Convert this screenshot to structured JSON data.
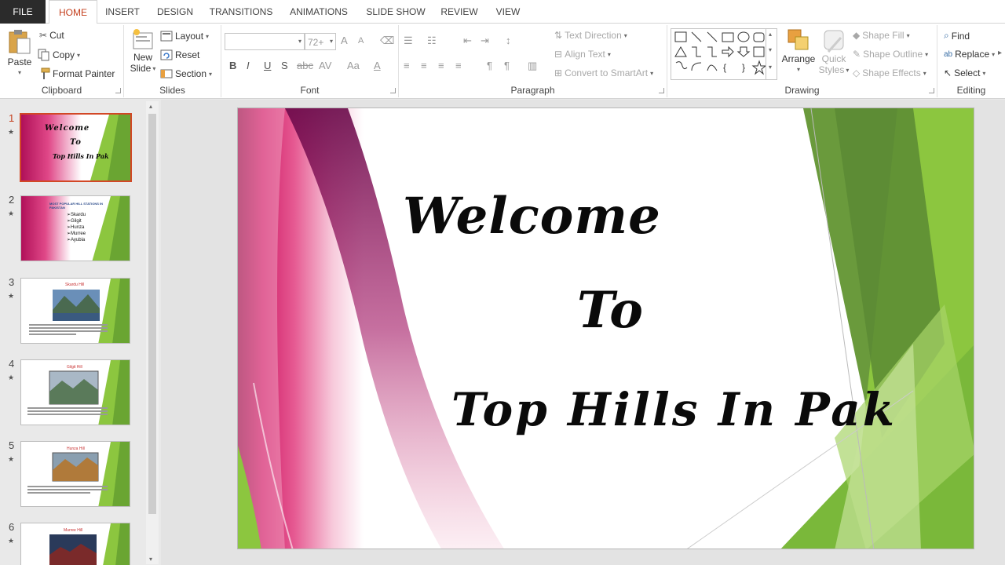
{
  "tabs": [
    {
      "label": "FILE"
    },
    {
      "label": "HOME"
    },
    {
      "label": "INSERT"
    },
    {
      "label": "DESIGN"
    },
    {
      "label": "TRANSITIONS"
    },
    {
      "label": "ANIMATIONS"
    },
    {
      "label": "SLIDE SHOW"
    },
    {
      "label": "REVIEW"
    },
    {
      "label": "VIEW"
    }
  ],
  "clipboard": {
    "paste": "Paste",
    "cut": "Cut",
    "copy": "Copy",
    "format_painter": "Format Painter",
    "label": "Clipboard"
  },
  "slides_group": {
    "new_slide_1": "New",
    "new_slide_2": "Slide",
    "layout": "Layout",
    "reset": "Reset",
    "section": "Section",
    "label": "Slides"
  },
  "font": {
    "size": "72+",
    "label": "Font",
    "bold": "B",
    "italic": "I",
    "underline": "U",
    "strike": "S",
    "spacing": "AV",
    "case": "Aa",
    "color": "A",
    "grow": "A",
    "shrink": "A"
  },
  "paragraph": {
    "label": "Paragraph",
    "text_direction": "Text Direction",
    "align_text": "Align Text",
    "smartart": "Convert to SmartArt"
  },
  "drawing": {
    "arrange": "Arrange",
    "quick_styles_1": "Quick",
    "quick_styles_2": "Styles",
    "shape_fill": "Shape Fill",
    "shape_outline": "Shape Outline",
    "shape_effects": "Shape Effects",
    "label": "Drawing"
  },
  "editing": {
    "find": "Find",
    "replace": "Replace",
    "select": "Select",
    "label": "Editing"
  },
  "thumbnails": [
    {
      "num": "1",
      "line1": "Welcome",
      "line2": "To",
      "line3": "Top Hills In Pak"
    },
    {
      "num": "2",
      "title": "MOST POPULAR HILL STATIONS IN PAKISTAN",
      "items": [
        "➢Skardu",
        "➢Gilgit",
        "➢Hunza",
        "➢Murree",
        "➢Ayubia"
      ]
    },
    {
      "num": "3",
      "title": "Skardu Hill"
    },
    {
      "num": "4",
      "title": "Gilgit Hill"
    },
    {
      "num": "5",
      "title": "Hunza Hill"
    },
    {
      "num": "6",
      "title": "Murree Hill"
    }
  ],
  "slide": {
    "line1": "Welcome",
    "line2": "To",
    "line3": "Top Hills In Pak"
  },
  "colors": {
    "accent": "#c43e1c",
    "green": "#8cc63f",
    "magenta": "#d6185f"
  }
}
